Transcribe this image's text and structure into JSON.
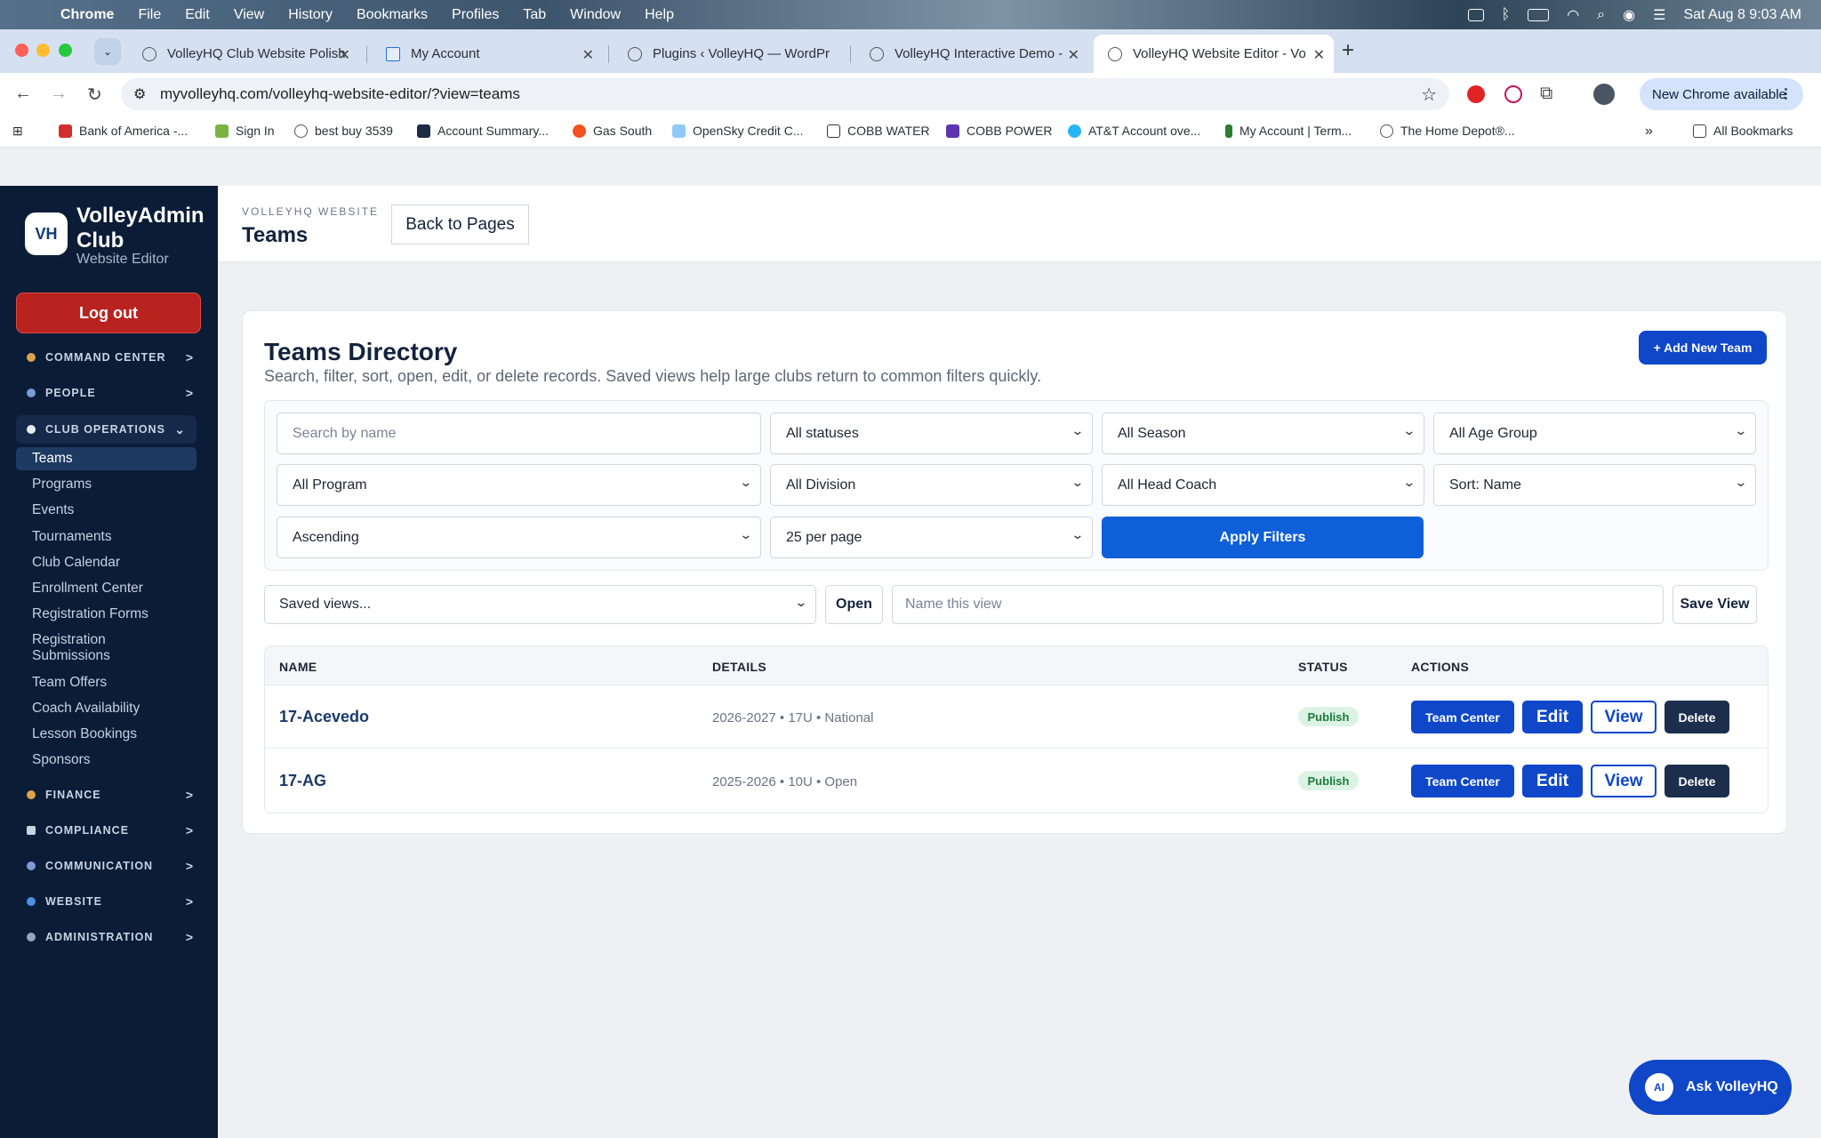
{
  "os_menubar": {
    "app": "Chrome",
    "menus": [
      "File",
      "Edit",
      "View",
      "History",
      "Bookmarks",
      "Profiles",
      "Tab",
      "Window",
      "Help"
    ],
    "datetime": "Sat Aug 8  9:03 AM"
  },
  "browser": {
    "tabs": [
      {
        "title": "VolleyHQ Club Website Polish"
      },
      {
        "title": "My Account"
      },
      {
        "title": "Plugins ‹ VolleyHQ — WordPr"
      },
      {
        "title": "VolleyHQ Interactive Demo - "
      },
      {
        "title": "VolleyHQ Website Editor - Vo",
        "active": true
      }
    ],
    "url": "myvolleyhq.com/volleyhq-website-editor/?view=teams",
    "update_label": "New Chrome available",
    "bookmarks": [
      "Bank of America -...",
      "Sign In",
      "best buy 3539",
      "Account Summary...",
      "Gas South",
      "OpenSky Credit C...",
      "COBB WATER",
      "COBB POWER",
      "AT&T Account ove...",
      "My Account | Term...",
      "The Home Depot®..."
    ],
    "all_bookmarks": "All Bookmarks"
  },
  "sidebar": {
    "logo": "VH",
    "brand_line1": "VolleyAdmin",
    "brand_line2": "Club",
    "subtitle": "Website Editor",
    "logout": "Log out",
    "sections_top": [
      {
        "label": "COMMAND CENTER",
        "icon": "home-icon"
      },
      {
        "label": "PEOPLE",
        "icon": "people-icon"
      }
    ],
    "open_section": {
      "label": "CLUB OPERATIONS",
      "icon": "circle-icon"
    },
    "items": [
      "Teams",
      "Programs",
      "Events",
      "Tournaments",
      "Club Calendar",
      "Enrollment Center",
      "Registration Forms",
      "Registration Submissions",
      "Team Offers",
      "Coach Availability",
      "Lesson Bookings",
      "Sponsors"
    ],
    "active_item": "Teams",
    "sections_bottom": [
      {
        "label": "FINANCE",
        "icon": "money-bag-icon"
      },
      {
        "label": "COMPLIANCE",
        "icon": "document-icon"
      },
      {
        "label": "COMMUNICATION",
        "icon": "megaphone-icon"
      },
      {
        "label": "WEBSITE",
        "icon": "globe-icon"
      },
      {
        "label": "ADMINISTRATION",
        "icon": "gear-icon"
      }
    ]
  },
  "header": {
    "eyebrow": "VOLLEYHQ WEBSITE",
    "title": "Teams",
    "back_button": "Back to Pages"
  },
  "directory": {
    "title": "Teams Directory",
    "description": "Search, filter, sort, open, edit, or delete records. Saved views help large clubs return to common filters quickly.",
    "add_button": "+ Add New Team",
    "filters": {
      "search_placeholder": "Search by name",
      "status": "All statuses",
      "season": "All Season",
      "age_group": "All Age Group",
      "program": "All Program",
      "division": "All Division",
      "head_coach": "All Head Coach",
      "sort": "Sort: Name",
      "order": "Ascending",
      "per_page": "25 per page",
      "apply": "Apply Filters"
    },
    "saved_views": {
      "select": "Saved views...",
      "open": "Open",
      "name_placeholder": "Name this view",
      "save": "Save View"
    },
    "columns": [
      "NAME",
      "DETAILS",
      "STATUS",
      "ACTIONS"
    ],
    "rows": [
      {
        "name": "17-Acevedo",
        "details": "2026-2027 • 17U • National",
        "status": "Publish"
      },
      {
        "name": "17-AG",
        "details": "2025-2026 • 10U • Open",
        "status": "Publish"
      }
    ],
    "actions": {
      "team_center": "Team Center",
      "edit": "Edit",
      "view": "View",
      "delete": "Delete"
    }
  },
  "assistant": {
    "badge": "AI",
    "label": "Ask VolleyHQ"
  },
  "colors": {
    "sidebar_bg": "#0b1c37",
    "primary": "#0f47c8",
    "danger": "#b8231f",
    "publish_bg": "#dcf3e4"
  }
}
